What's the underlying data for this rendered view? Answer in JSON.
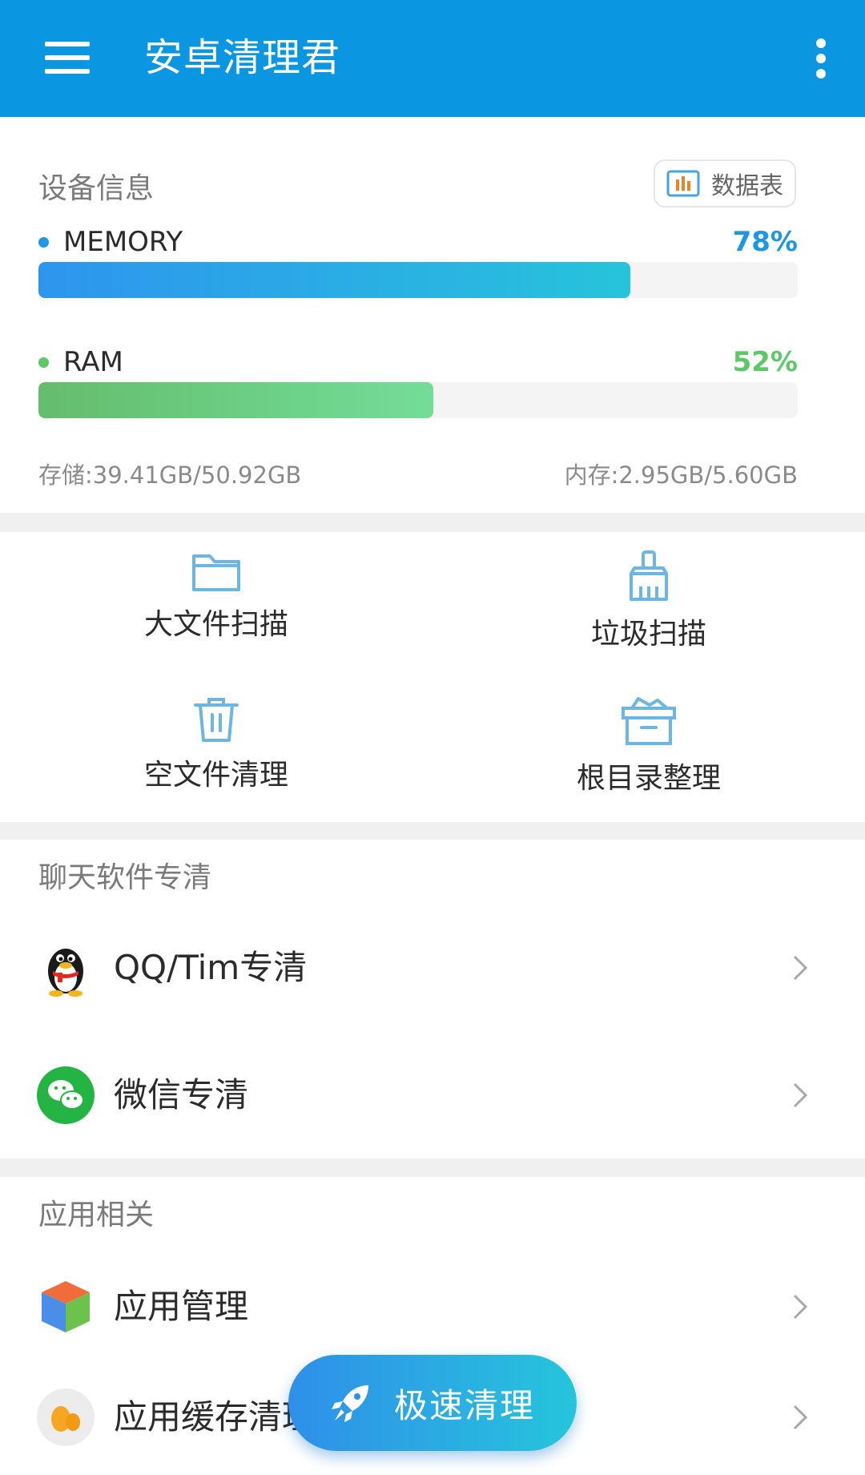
{
  "appbar": {
    "title": "安卓清理君",
    "menu_icon": "hamburger-menu-icon",
    "more_icon": "more-vertical-icon"
  },
  "device": {
    "title": "设备信息",
    "datatable_label": "数据表",
    "memory": {
      "label": "MEMORY",
      "percent_text": "78%",
      "percent": 78,
      "color": "#1e96e6"
    },
    "ram": {
      "label": "RAM",
      "percent_text": "52%",
      "percent": 52,
      "color": "#5cc866"
    },
    "storage_text": "存储:39.41GB/50.92GB",
    "memory_text": "内存:2.95GB/5.60GB"
  },
  "tools": [
    {
      "label": "大文件扫描",
      "icon": "folder-icon"
    },
    {
      "label": "垃圾扫描",
      "icon": "broom-icon"
    },
    {
      "label": "空文件清理",
      "icon": "trash-icon"
    },
    {
      "label": "根目录整理",
      "icon": "archive-box-icon"
    }
  ],
  "chat": {
    "title": "聊天软件专清",
    "items": [
      {
        "label": "QQ/Tim专清",
        "icon": "qq-penguin-icon"
      },
      {
        "label": "微信专清",
        "icon": "wechat-icon"
      }
    ]
  },
  "apps": {
    "title": "应用相关",
    "items": [
      {
        "label": "应用管理",
        "icon": "app-cube-icon"
      },
      {
        "label": "应用缓存清理",
        "icon": "cache-icon"
      }
    ]
  },
  "fab": {
    "label": "极速清理",
    "icon": "rocket-icon"
  },
  "colors": {
    "primary": "#0a96e0",
    "icon_blue": "#6bb6e2",
    "background": "#f0f0f0"
  }
}
